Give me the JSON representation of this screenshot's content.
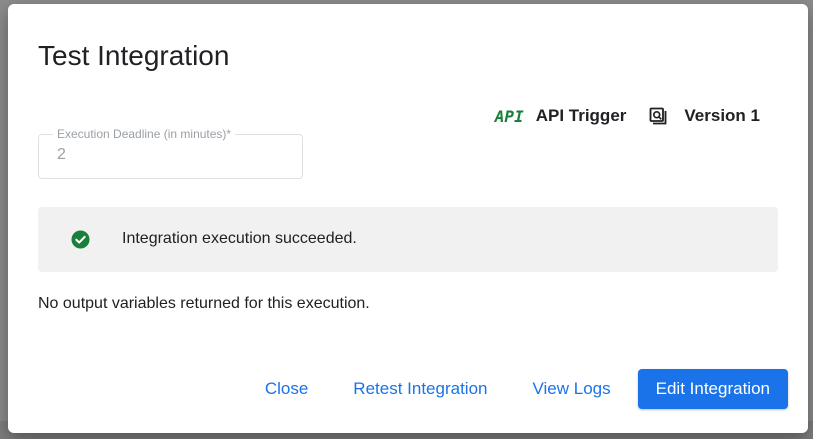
{
  "dialog": {
    "title": "Test Integration"
  },
  "trigger": {
    "icon": "api-icon",
    "icon_text": "API",
    "label": "API Trigger"
  },
  "version": {
    "icon": "version-icon",
    "label": "Version 1"
  },
  "deadline": {
    "label": "Execution Deadline (in minutes)*",
    "value": "2"
  },
  "status": {
    "icon": "check-circle-icon",
    "message": "Integration execution succeeded.",
    "color": "#188038"
  },
  "output": {
    "message": "No output variables returned for this execution."
  },
  "actions": {
    "close": "Close",
    "retest": "Retest Integration",
    "view_logs": "View Logs",
    "edit": "Edit Integration"
  },
  "colors": {
    "accent": "#1a73e8",
    "success": "#188038",
    "banner_bg": "#f1f1f1"
  }
}
